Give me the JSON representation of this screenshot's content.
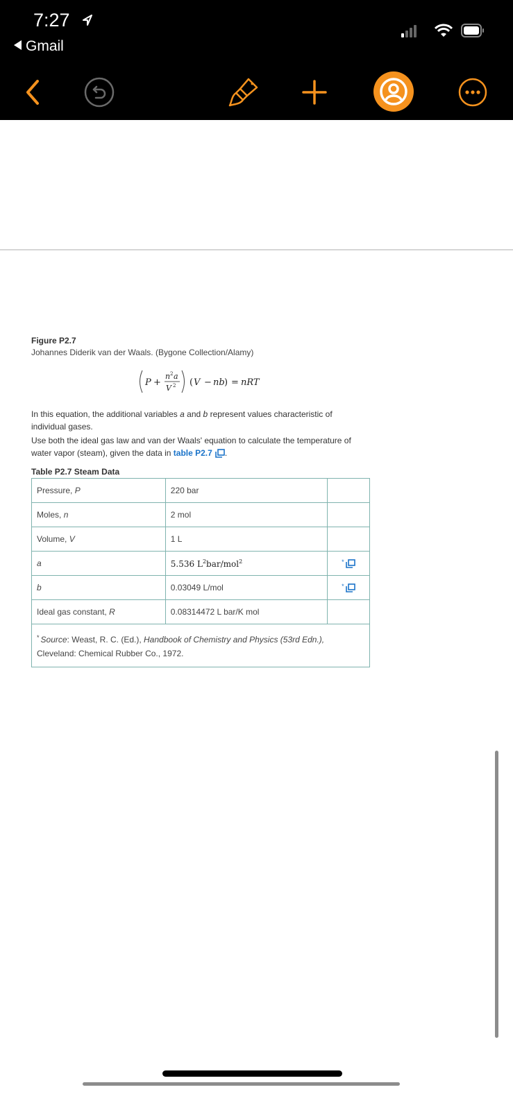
{
  "status_bar": {
    "time": "7:27",
    "back_app": "Gmail"
  },
  "toolbar": {
    "accent_color": "#f5921e",
    "icons": [
      "chevron-left-icon",
      "undo-icon",
      "paintbrush-icon",
      "plus-icon",
      "profile-icon",
      "more-icon"
    ]
  },
  "figure": {
    "title": "Figure P2.7",
    "caption": "Johannes Diderik van der Waals. (Bygone Collection/Alamy)"
  },
  "paragraph1": {
    "t1": "In this equation, the additional variables ",
    "v1": "a",
    "t2": " and ",
    "v2": "b",
    "t3": " represent values characteristic of individual gases."
  },
  "paragraph2": {
    "text": "Use both the ideal gas law and van der Waals' equation to calculate the temperature of water vapor (steam), given the data in ",
    "link": "table P2.7",
    "end": "."
  },
  "table": {
    "title": "Table P2.7  Steam Data",
    "rows": [
      {
        "name_text": "Pressure, ",
        "name_var": "P",
        "value": "220 bar",
        "note": ""
      },
      {
        "name_text": "Moles, ",
        "name_var": "n",
        "value": "2 mol",
        "note": ""
      },
      {
        "name_text": "Volume, ",
        "name_var": "V",
        "value": "1 L",
        "note": ""
      },
      {
        "name_text": "",
        "name_var": "a",
        "value": "",
        "note": "*"
      },
      {
        "name_text": "",
        "name_var": "b",
        "value": "0.03049 L/mol",
        "note": "*"
      },
      {
        "name_text": "Ideal gas constant, ",
        "name_var": "R",
        "value": "0.08314472 L bar/K mol",
        "note": ""
      }
    ],
    "a_value": {
      "num": "5.536",
      "unit1": "L",
      "unit2": "bar/mol",
      "exp": "2"
    },
    "source": {
      "marker": "*",
      "label": "Source",
      "t1": ": Weast, R. C. (Ed.), ",
      "book": "Handbook of Chemistry and Physics (53rd Edn.),",
      "t2": "Cleveland: Chemical Rubber Co., 1972."
    }
  }
}
